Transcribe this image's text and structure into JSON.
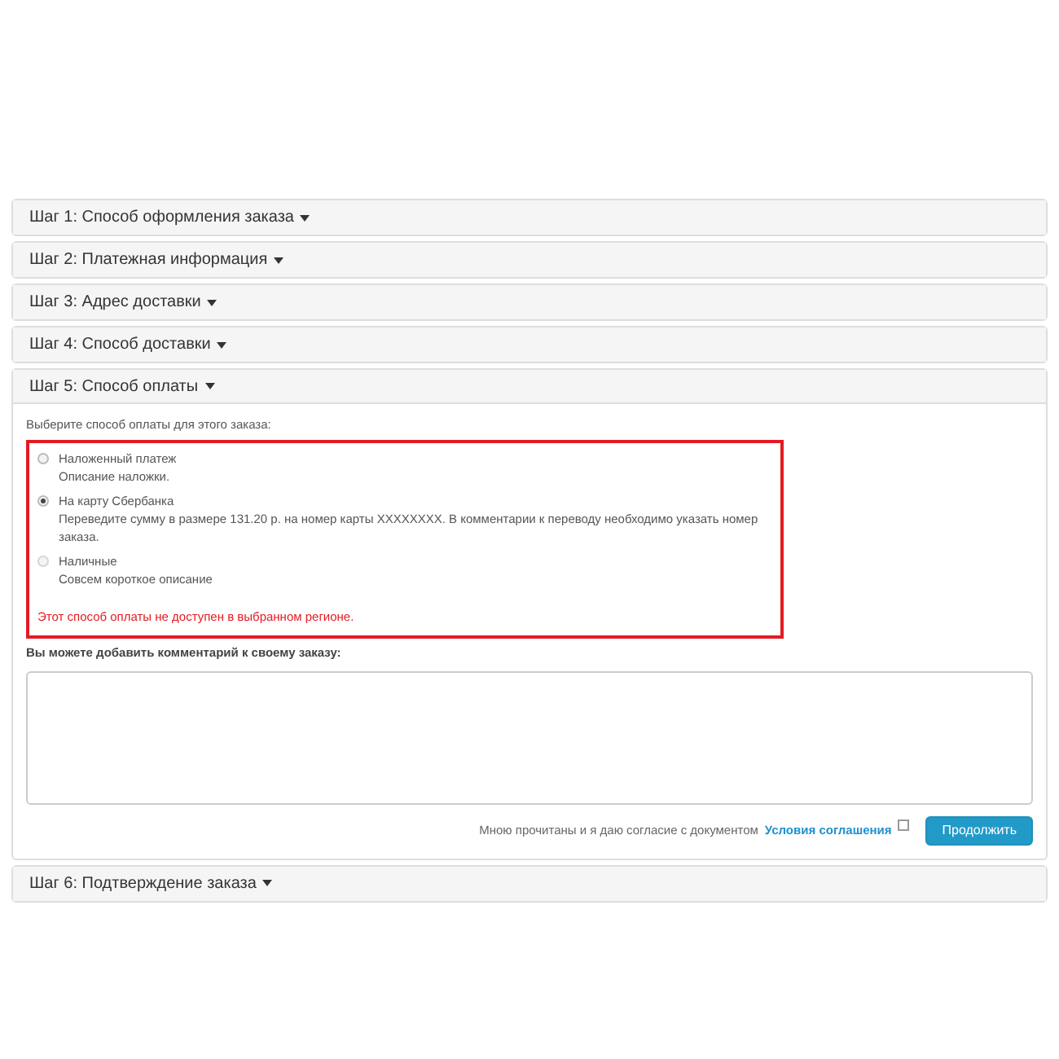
{
  "steps": [
    {
      "title": "Шаг 1: Способ оформления заказа",
      "expanded": false
    },
    {
      "title": "Шаг 2: Платежная информация",
      "expanded": false
    },
    {
      "title": "Шаг 3: Адрес доставки",
      "expanded": false
    },
    {
      "title": "Шаг 4: Способ доставки",
      "expanded": false
    },
    {
      "title": "Шаг 5: Способ оплаты",
      "expanded": true
    },
    {
      "title": "Шаг 6: Подтверждение заказа",
      "expanded": false
    }
  ],
  "payment": {
    "prompt": "Выберите способ оплаты для этого заказа:",
    "options": [
      {
        "label": "Наложенный платеж",
        "description": "Описание наложки.",
        "selected": false,
        "disabled": false
      },
      {
        "label": "На карту Сбербанка",
        "description": "Переведите сумму в размере 131.20 р. на номер карты XXXXXXXX. В комментарии к переводу необходимо указать номер заказа.",
        "selected": true,
        "disabled": false
      },
      {
        "label": "Наличные",
        "description": "Совсем короткое описание",
        "selected": false,
        "disabled": true
      }
    ],
    "warning": "Этот способ оплаты не доступен в выбранном регионе.",
    "comment_label": "Вы можете добавить комментарий к своему заказу:",
    "agreement_text": "Мною прочитаны и я даю согласие с документом",
    "agreement_link": "Условия соглашения",
    "agreement_checked": false,
    "continue_button": "Продолжить"
  }
}
